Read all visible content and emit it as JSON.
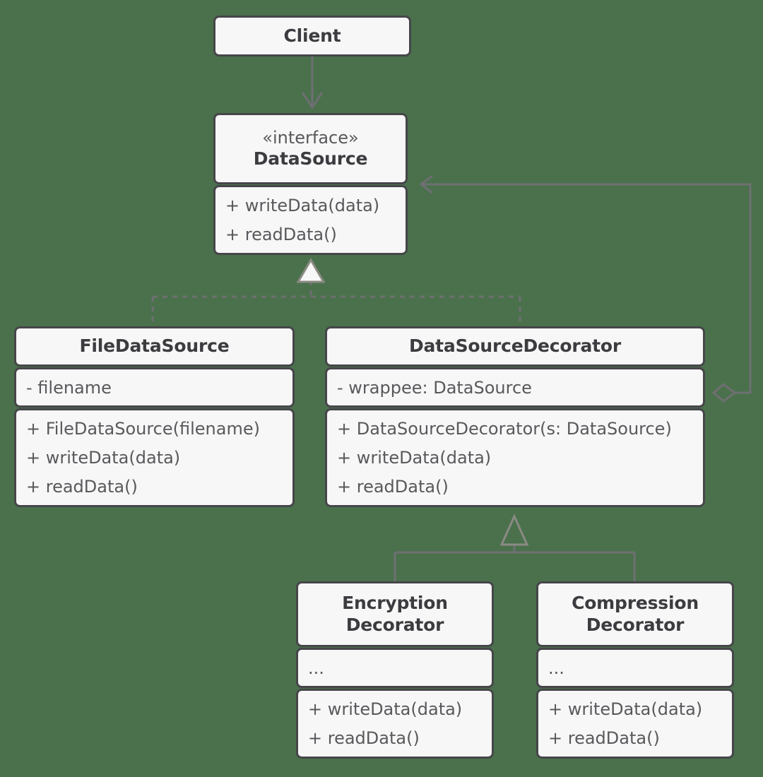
{
  "diagram": {
    "title": "Decorator pattern UML class diagram",
    "background_color": "#4a714c",
    "box_fill_color": "#f7f7f7",
    "box_border_color": "#46464a",
    "edge_color": "#6f6f72",
    "text_color": "#59595d",
    "heading_color": "#3c3c40"
  },
  "classes": {
    "client": {
      "name": "Client",
      "stereotype": "",
      "attributes": [],
      "methods": []
    },
    "data_source": {
      "name": "DataSource",
      "stereotype": "«interface»",
      "attributes": [],
      "methods": [
        "+ writeData(data)",
        "+ readData()"
      ]
    },
    "file_data_source": {
      "name": "FileDataSource",
      "stereotype": "",
      "attributes": [
        "- filename"
      ],
      "methods": [
        "+ FileDataSource(filename)",
        "+ writeData(data)",
        "+ readData()"
      ]
    },
    "data_source_decorator": {
      "name": "DataSourceDecorator",
      "stereotype": "",
      "attributes": [
        "- wrappee: DataSource"
      ],
      "methods": [
        "+ DataSourceDecorator(s: DataSource)",
        "+ writeData(data)",
        "+ readData()"
      ]
    },
    "encryption_decorator": {
      "name_line1": "Encryption",
      "name_line2": "Decorator",
      "attributes": [
        "..."
      ],
      "methods": [
        "+ writeData(data)",
        "+ readData()"
      ]
    },
    "compression_decorator": {
      "name_line1": "Compression",
      "name_line2": "Decorator",
      "attributes": [
        "..."
      ],
      "methods": [
        "+ writeData(data)",
        "+ readData()"
      ]
    }
  },
  "relationships": [
    {
      "id": "client-uses-datasource",
      "from": "Client",
      "to": "DataSource",
      "type": "association",
      "line": "solid",
      "arrow": "open-arrow"
    },
    {
      "id": "filedatasource-implements-datasource",
      "from": "FileDataSource",
      "to": "DataSource",
      "type": "realization",
      "line": "dashed",
      "arrow": "hollow-triangle"
    },
    {
      "id": "datasourcedecorator-implements-datasource",
      "from": "DataSourceDecorator",
      "to": "DataSource",
      "type": "realization",
      "line": "dashed",
      "arrow": "hollow-triangle"
    },
    {
      "id": "datasourcedecorator-aggregates-datasource",
      "from": "DataSourceDecorator",
      "to": "DataSource",
      "type": "aggregation",
      "line": "solid",
      "arrow": "open-arrow",
      "source_decoration": "hollow-diamond"
    },
    {
      "id": "encryptiondecorator-extends-datasourcedecorator",
      "from": "EncryptionDecorator",
      "to": "DataSourceDecorator",
      "type": "generalization",
      "line": "solid",
      "arrow": "hollow-triangle"
    },
    {
      "id": "compressiondecorator-extends-datasourcedecorator",
      "from": "CompressionDecorator",
      "to": "DataSourceDecorator",
      "type": "generalization",
      "line": "solid",
      "arrow": "hollow-triangle"
    }
  ]
}
